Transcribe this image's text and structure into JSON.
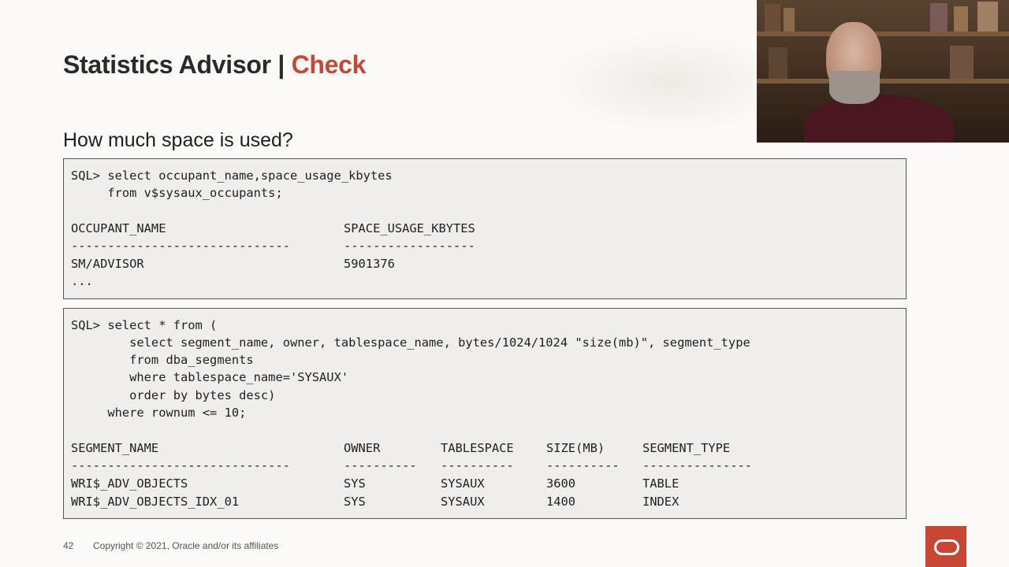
{
  "slide": {
    "title_main": "Statistics Advisor | ",
    "title_accent": "Check",
    "subtitle": "How much space is used?"
  },
  "query1": {
    "lines": [
      "SQL> select occupant_name,space_usage_kbytes",
      "     from v$sysaux_occupants;"
    ],
    "headers": [
      "OCCUPANT_NAME",
      "SPACE_USAGE_KBYTES"
    ],
    "dashes": [
      "------------------------------",
      "------------------"
    ],
    "rows": [
      [
        "SM/ADVISOR",
        "5901376"
      ]
    ],
    "ellipsis": "..."
  },
  "query2": {
    "lines": [
      "SQL> select * from (",
      "        select segment_name, owner, tablespace_name, bytes/1024/1024 \"size(mb)\", segment_type",
      "        from dba_segments",
      "        where tablespace_name='SYSAUX'",
      "        order by bytes desc)",
      "     where rownum <= 10;"
    ],
    "headers": [
      "SEGMENT_NAME",
      "OWNER",
      "TABLESPACE",
      "SIZE(MB)",
      "SEGMENT_TYPE"
    ],
    "dashes": [
      "------------------------------",
      "----------",
      "----------",
      "----------",
      "---------------"
    ],
    "rows": [
      [
        "WRI$_ADV_OBJECTS",
        "SYS",
        "SYSAUX",
        "3600",
        "TABLE"
      ],
      [
        "WRI$_ADV_OBJECTS_IDX_01",
        "SYS",
        "SYSAUX",
        "1400",
        "INDEX"
      ]
    ]
  },
  "footer": {
    "page_number": "42",
    "copyright": "Copyright © 2021, Oracle and/or its affiliates"
  },
  "colors": {
    "accent": "#c74634",
    "background": "#fbfaf8",
    "code_background": "#efeeec"
  }
}
